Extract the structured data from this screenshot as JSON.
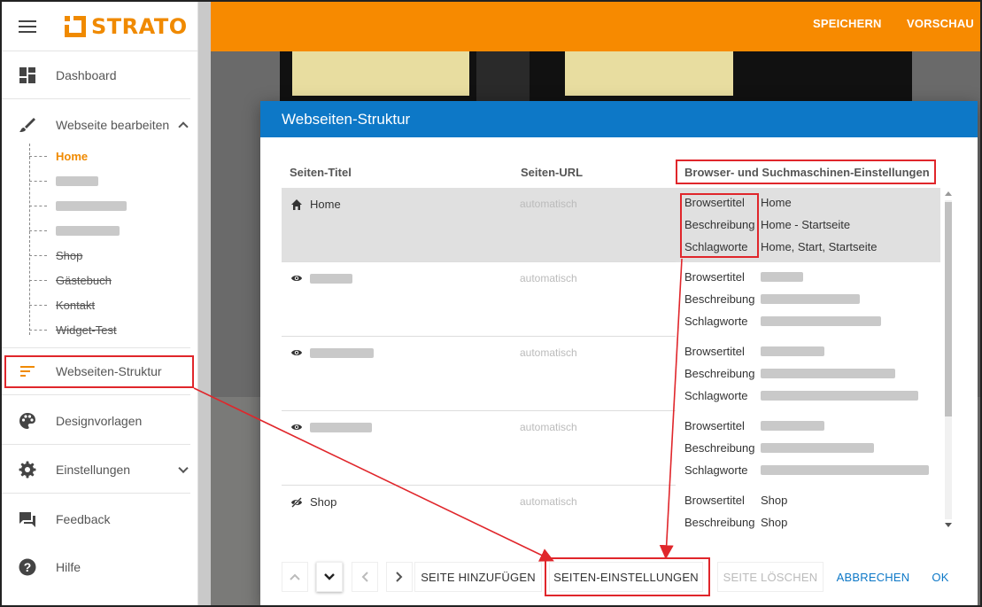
{
  "brand": {
    "name": "STRATO",
    "color": "#f08a00"
  },
  "sidebar": {
    "menu_icon": "hamburger-icon",
    "items": [
      {
        "label": "Dashboard",
        "icon": "dashboard-icon"
      },
      {
        "label": "Webseite bearbeiten",
        "icon": "brush-icon"
      },
      {
        "label": "Webseiten-Struktur",
        "icon": "structure-icon"
      },
      {
        "label": "Designvorlagen",
        "icon": "palette-icon"
      },
      {
        "label": "Einstellungen",
        "icon": "gear-icon"
      },
      {
        "label": "Feedback",
        "icon": "feedback-icon"
      },
      {
        "label": "Hilfe",
        "icon": "help-icon"
      }
    ],
    "tree": [
      "Home",
      "",
      "",
      "",
      "Shop",
      "Gästebuch",
      "Kontakt",
      "Widget-Test"
    ]
  },
  "topbar": {
    "save": "SPEICHERN",
    "preview": "VORSCHAU",
    "color": "#f78a00"
  },
  "dialog": {
    "title": "Webseiten-Struktur",
    "columns": {
      "title": "Seiten-Titel",
      "url": "Seiten-URL",
      "settings": "Browser- und Suchmaschinen-Einstellungen"
    },
    "meta_labels": {
      "browsertitel": "Browsertitel",
      "beschreibung": "Beschreibung",
      "schlagworte": "Schlagworte"
    },
    "rows": [
      {
        "title": "Home",
        "icon": "home-icon",
        "url": "automatisch",
        "browsertitel": "Home",
        "beschreibung": "Home - Startseite",
        "schlagworte": "Home, Start, Startseite"
      },
      {
        "title": "",
        "icon": "eye-icon",
        "url": "automatisch",
        "browsertitel": "",
        "beschreibung": "",
        "schlagworte": ""
      },
      {
        "title": "",
        "icon": "eye-icon",
        "url": "automatisch",
        "browsertitel": "",
        "beschreibung": "",
        "schlagworte": ""
      },
      {
        "title": "",
        "icon": "eye-icon",
        "url": "automatisch",
        "browsertitel": "",
        "beschreibung": "",
        "schlagworte": ""
      },
      {
        "title": "Shop",
        "icon": "eye-off-icon",
        "url": "automatisch",
        "browsertitel": "Shop",
        "beschreibung": "Shop",
        "schlagworte": ""
      }
    ],
    "buttons": {
      "add": "SEITE HINZUFÜGEN",
      "settings": "SEITEN-EINSTELLUNGEN",
      "delete": "SEITE LÖSCHEN",
      "cancel": "ABBRECHEN",
      "ok": "OK"
    },
    "accent": "#0d78c7"
  },
  "annotation_color": "#e0262b"
}
